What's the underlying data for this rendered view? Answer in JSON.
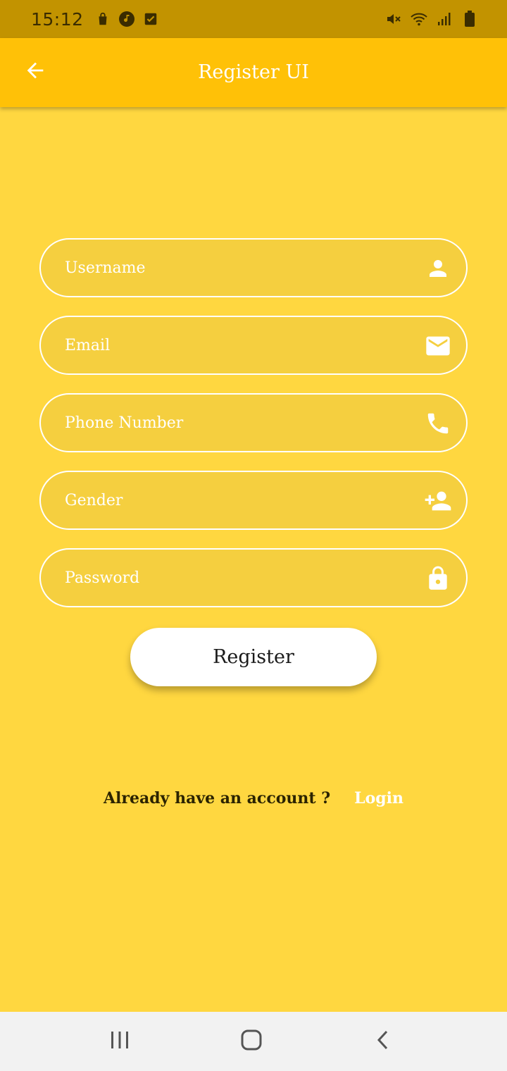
{
  "status_bar": {
    "time": "15:12",
    "left_icons": [
      "shopping-bag-icon",
      "music-note-icon",
      "checkbox-icon"
    ],
    "right_icons": [
      "mute-icon",
      "wifi-icon",
      "signal-icon",
      "battery-icon"
    ]
  },
  "app_bar": {
    "title": "Register UI",
    "back_icon": "arrow-left-icon"
  },
  "form": {
    "fields": [
      {
        "placeholder": "Username",
        "value": "",
        "icon": "person-icon"
      },
      {
        "placeholder": "Email",
        "value": "",
        "icon": "mail-icon"
      },
      {
        "placeholder": "Phone Number",
        "value": "",
        "icon": "phone-icon"
      },
      {
        "placeholder": "Gender",
        "value": "",
        "icon": "person-add-icon"
      },
      {
        "placeholder": "Password",
        "value": "",
        "icon": "lock-icon"
      }
    ],
    "register_label": "Register"
  },
  "footer": {
    "question": "Already have an account ?",
    "login_label": "Login"
  },
  "nav_bar": {
    "icons": [
      "recent-apps-icon",
      "home-icon",
      "back-icon"
    ]
  },
  "colors": {
    "background": "#FFD740",
    "app_bar": "#FFC107",
    "status_bar": "#C29300",
    "field_fill": "#F5CF3F",
    "text_on_yellow": "#FFFFFF"
  }
}
